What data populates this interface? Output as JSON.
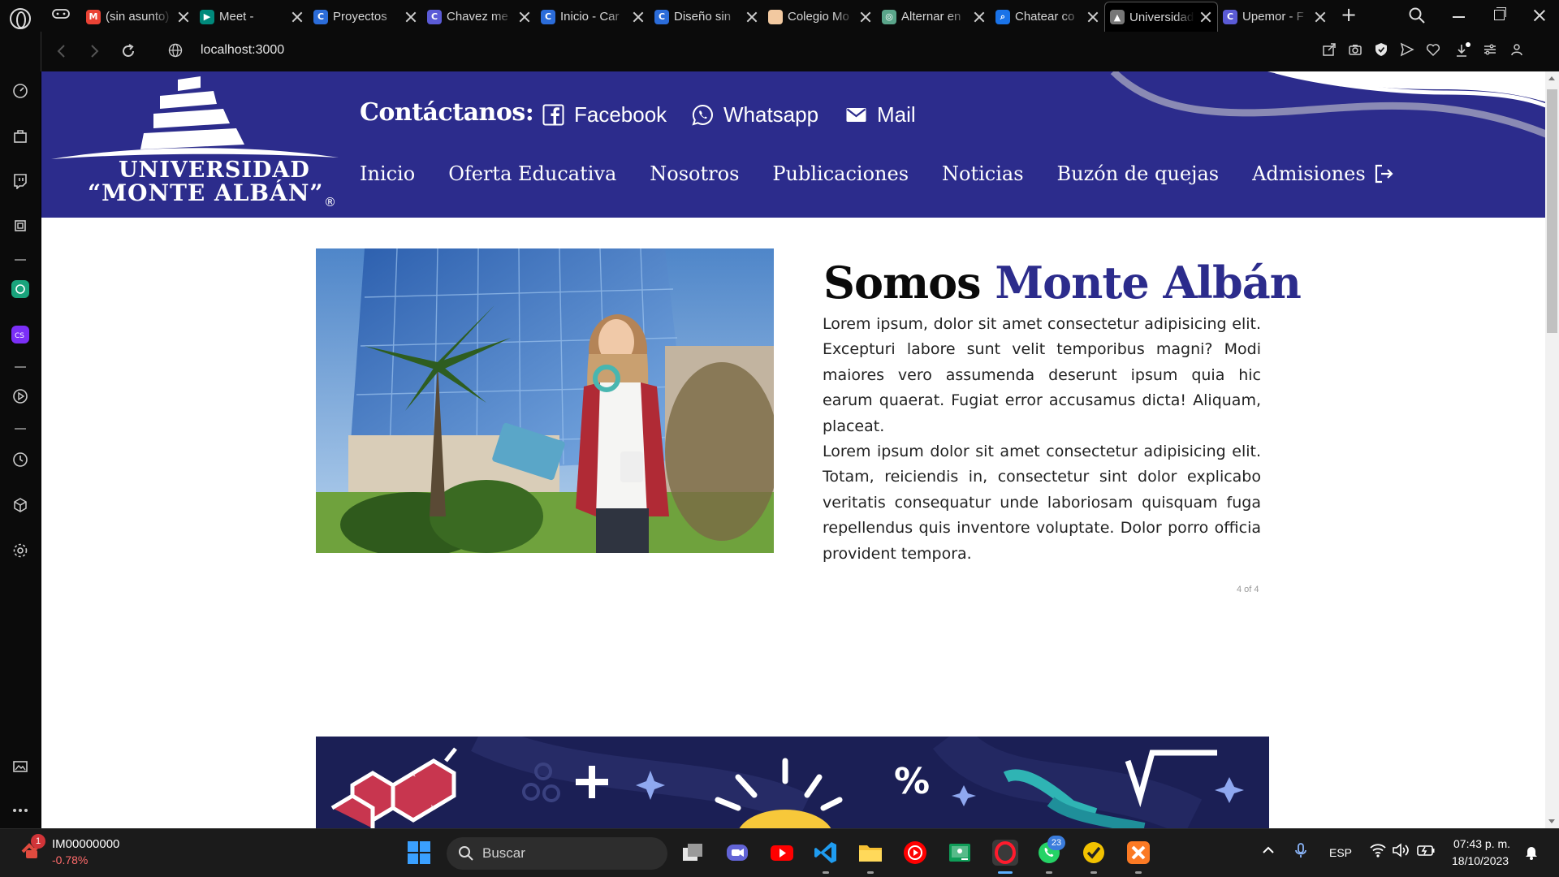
{
  "browser": {
    "tabs": [
      {
        "label": "(sin asunto)",
        "color": "#ea4335",
        "glyph": "M"
      },
      {
        "label": "Meet - ",
        "color": "#00897b",
        "glyph": "▶"
      },
      {
        "label": "Proyectos",
        "color": "#2b6cd9",
        "glyph": "C"
      },
      {
        "label": "Chavez me",
        "color": "#5b5bd6",
        "glyph": "C"
      },
      {
        "label": "Inicio - Car",
        "color": "#2b6cd9",
        "glyph": "C"
      },
      {
        "label": "Diseño sin",
        "color": "#2b6cd9",
        "glyph": "C"
      },
      {
        "label": "Colegio Mo",
        "color": "#f2c9a0",
        "glyph": ""
      },
      {
        "label": "Alternar en",
        "color": "#5aa58a",
        "glyph": "◎"
      },
      {
        "label": "Chatear co",
        "color": "#1a73e8",
        "glyph": "⌕"
      },
      {
        "label": "Universidad",
        "color": "#777777",
        "glyph": "▲"
      },
      {
        "label": "Upemor - F",
        "color": "#5b5bd6",
        "glyph": "C"
      }
    ],
    "active_tab": 9,
    "url": "localhost:3000"
  },
  "site": {
    "logo_line1": "UNIVERSIDAD",
    "logo_line2": "“MONTE ALBÁN”",
    "logo_reg": "®",
    "contact_title": "Contáctanos:",
    "contact_links": {
      "facebook": "Facebook",
      "whatsapp": "Whatsapp",
      "mail": "Mail"
    },
    "nav": [
      "Inicio",
      "Oferta Educativa",
      "Nosotros",
      "Publicaciones",
      "Noticias",
      "Buzón de quejas",
      "Admisiones"
    ],
    "brand_color": "#2c2c8c",
    "about": {
      "title_plain": "Somos ",
      "title_accent": "Monte Albán",
      "paragraph1": "Lorem ipsum, dolor sit amet consectetur adipisicing elit. Excepturi labore sunt velit temporibus magni? Modi maiores vero assumenda deserunt ipsum quia hic earum quaerat. Fugiat error accusamus dicta! Aliquam, placeat.",
      "paragraph2": "Lorem ipsum dolor sit amet consectetur adipisicing elit. Totam, reiciendis in, consectetur sint dolor explicabo veritatis consequatur unde laboriosam quisquam fuga repellendus quis inventore voluptate. Dolor porro officia provident tempora."
    },
    "slide_counter": "4 of 4"
  },
  "taskbar": {
    "stock_name": "IM00000000",
    "stock_change": "-0.78%",
    "stock_badge": "1",
    "search_placeholder": "Buscar",
    "whatsapp_badge": "23",
    "lang": "ESP",
    "time": "07:43 p. m.",
    "date": "18/10/2023"
  }
}
